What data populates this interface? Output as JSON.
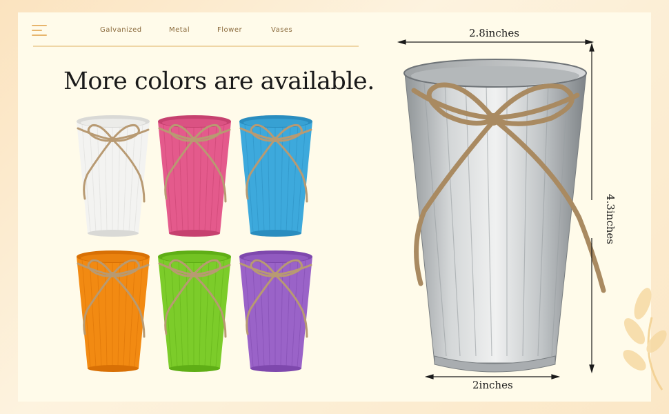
{
  "nav": {
    "items": [
      "Galvanized",
      "Metal",
      "Flower",
      "Vases"
    ]
  },
  "heading": "More colors are available.",
  "vases": [
    {
      "color_name": "white",
      "body": "#f3f3f1",
      "shade": "#d9d9d6"
    },
    {
      "color_name": "pink",
      "body": "#e45a8c",
      "shade": "#c6416f"
    },
    {
      "color_name": "blue",
      "body": "#3da9dc",
      "shade": "#2a8dbf"
    },
    {
      "color_name": "orange",
      "body": "#f28a12",
      "shade": "#d87005"
    },
    {
      "color_name": "green",
      "body": "#7ccc2a",
      "shade": "#5fae16"
    },
    {
      "color_name": "purple",
      "body": "#9a63c8",
      "shade": "#7e48ad"
    }
  ],
  "dimensions": {
    "top": "2.8inches",
    "bottom": "2inches",
    "side": "4.3inches"
  },
  "colors": {
    "accent": "#e7b56c",
    "twine": "#b89a72",
    "galvanized": "#b8bcbf"
  }
}
